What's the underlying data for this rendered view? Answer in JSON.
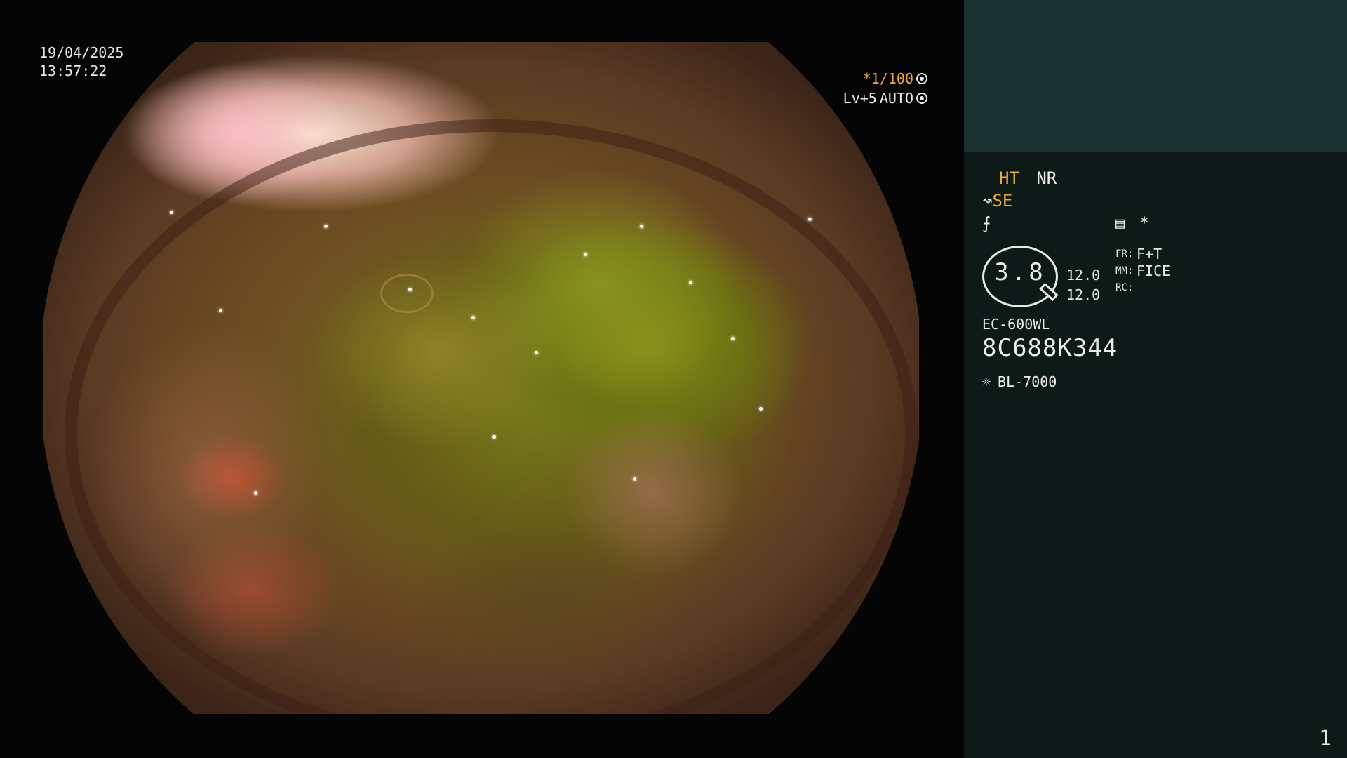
{
  "overlay": {
    "date": "19/04/2025",
    "time": "13:57:22",
    "shutter": "*1/100",
    "level": "Lv+5",
    "mode": "AUTO"
  },
  "info": {
    "ht": "HT",
    "nr": "NR",
    "se": "SE",
    "se_icon": "wave-arrow-icon",
    "enhance_icon": "slash-f-icon",
    "menu_icon": "list-box-icon",
    "asterisk": "*",
    "lens_value": "3.8",
    "lens_num1": "12.0",
    "lens_num2": "12.0",
    "fr_label": "FR:",
    "fr_value": "F+T",
    "mm_label": "MM:",
    "mm_value": "FICE",
    "rc_label": "RC:",
    "rc_value": "",
    "model": "EC-600WL",
    "serial": "8C688K344",
    "light_source": "BL-7000",
    "light_icon": "sun-icon"
  },
  "page_number": "1",
  "colors": {
    "accent_orange": "#f0a838",
    "panel_bg": "#0e1a18",
    "thumb_bg": "#1a302e",
    "text": "#e8e8e8"
  }
}
